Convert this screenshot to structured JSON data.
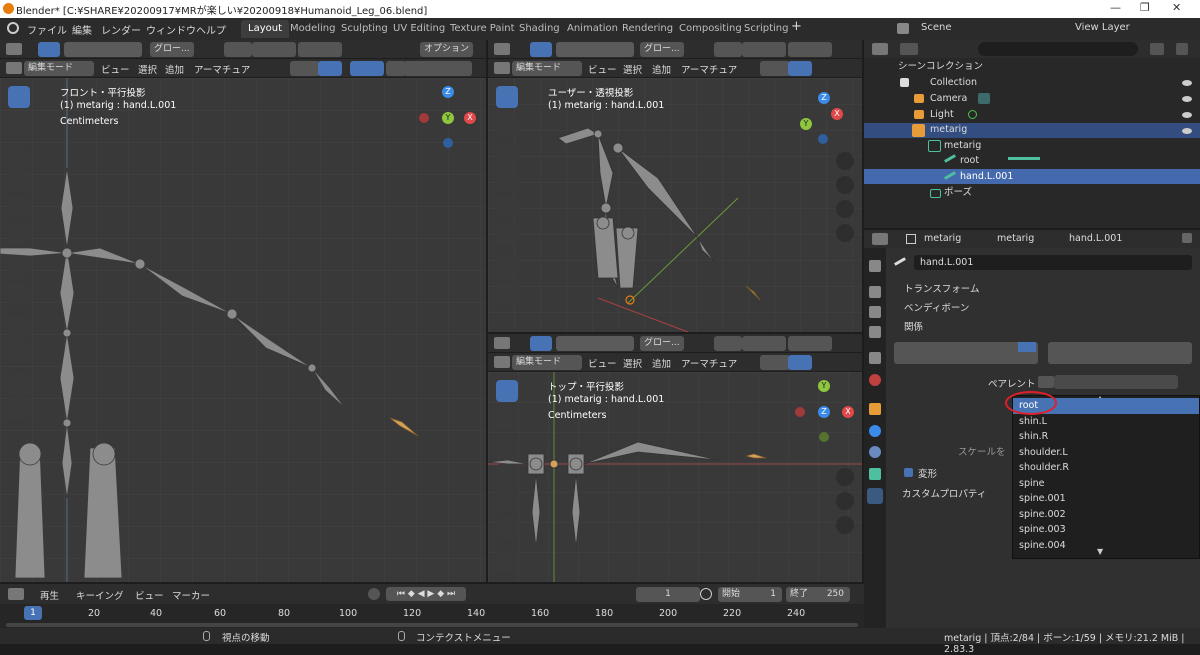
{
  "window": {
    "title": "Blender* [C:¥SHARE¥20200917¥MRが楽しい¥20200918¥Humanoid_Leg_06.blend]",
    "minimize": "—",
    "maximize": "❐",
    "close": "✕"
  },
  "menu": {
    "items": [
      "ファイル",
      "編集",
      "レンダー",
      "ウィンドウ",
      "ヘルプ"
    ]
  },
  "workspace_tabs": [
    "Layout",
    "Modeling",
    "Sculpting",
    "UV Editing",
    "Texture Paint",
    "Shading",
    "Animation",
    "Rendering",
    "Compositing",
    "Scripting"
  ],
  "workspace_add": "+",
  "scene": {
    "label": "Scene",
    "view_layer": "View Layer"
  },
  "viewport_header": {
    "transform_orientation": "グロー...",
    "options": "オプション",
    "mode": "編集モード",
    "view": "ビュー",
    "select": "選択",
    "add": "追加",
    "armature": "アーマチュア"
  },
  "viewports": {
    "front": {
      "view_name": "フロント・平行投影",
      "object": "(1) metarig : hand.L.001",
      "units": "Centimeters"
    },
    "user": {
      "view_name": "ユーザー・透視投影",
      "object": "(1) metarig : hand.L.001"
    },
    "top": {
      "view_name": "トップ・平行投影",
      "object": "(1) metarig : hand.L.001",
      "units": "Centimeters"
    }
  },
  "gizmo": {
    "z": "Z",
    "y": "Y",
    "x": "X"
  },
  "outliner": {
    "root": "シーンコレクション",
    "collection": "Collection",
    "camera": "Camera",
    "light": "Light",
    "metarig": "metarig",
    "metarig_data": "metarig",
    "root_bone": "root",
    "hand": "hand.L.001",
    "pose": "ポーズ"
  },
  "properties": {
    "breadcrumb": [
      "metarig",
      "metarig",
      "hand.L.001"
    ],
    "bone_name": "hand.L.001",
    "sections": {
      "transform": "トランスフォーム",
      "bendy": "ベンディボーン",
      "relations": "関係",
      "deform": "変形",
      "custom": "カスタムプロパティ"
    },
    "parent_label": "ペアレント",
    "scale_partial": "スケールを"
  },
  "parent_dropdown": {
    "options": [
      "root",
      "shin.L",
      "shin.R",
      "shoulder.L",
      "shoulder.R",
      "spine",
      "spine.001",
      "spine.002",
      "spine.003",
      "spine.004"
    ],
    "selected": "root"
  },
  "timeline": {
    "playback": "再生",
    "keying": "キーイング",
    "view": "ビュー",
    "marker": "マーカー",
    "current_frame": "1",
    "start_label": "開始",
    "start": "1",
    "end_label": "終了",
    "end": "250",
    "ticks": [
      "1",
      "20",
      "40",
      "60",
      "80",
      "100",
      "120",
      "140",
      "160",
      "180",
      "200",
      "220",
      "240"
    ]
  },
  "status": {
    "left_hint": "視点の移動",
    "right_hint": "コンテクストメニュー",
    "stats": "metarig | 頂点:2/84 | ボーン:1/59 | メモリ:21.2 MiB | 2.83.3"
  },
  "colors": {
    "accent": "#4772b3",
    "highlight_circle": "#e0202a",
    "x_axis": "#e0484a",
    "y_axis": "#8ec63f",
    "z_axis": "#3b8bea"
  }
}
